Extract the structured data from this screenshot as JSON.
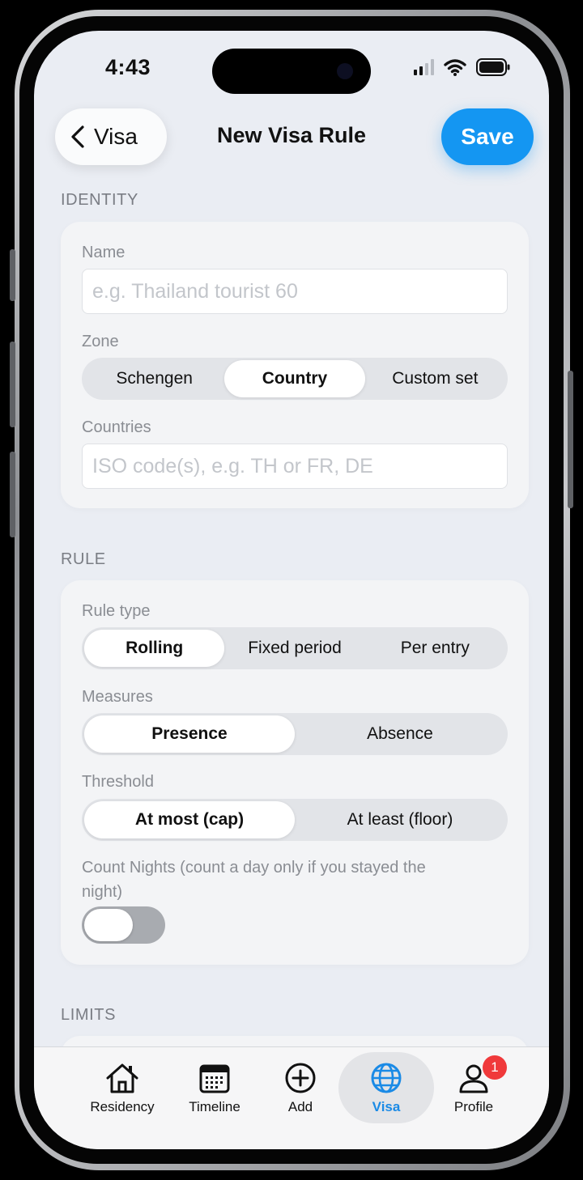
{
  "status_bar": {
    "time": "4:43"
  },
  "nav": {
    "back_label": "Visa",
    "title": "New Visa Rule",
    "save_label": "Save"
  },
  "identity": {
    "header": "IDENTITY",
    "name_label": "Name",
    "name_placeholder": "e.g. Thailand tourist 60",
    "zone_label": "Zone",
    "zone_options": [
      "Schengen",
      "Country",
      "Custom set"
    ],
    "zone_selected": "Country",
    "countries_label": "Countries",
    "countries_placeholder": "ISO code(s), e.g. TH or FR, DE"
  },
  "rule": {
    "header": "RULE",
    "rule_type_label": "Rule type",
    "rule_type_options": [
      "Rolling",
      "Fixed period",
      "Per entry"
    ],
    "rule_type_selected": "Rolling",
    "measures_label": "Measures",
    "measures_options": [
      "Presence",
      "Absence"
    ],
    "measures_selected": "Presence",
    "threshold_label": "Threshold",
    "threshold_options": [
      "At most (cap)",
      "At least (floor)"
    ],
    "threshold_selected": "At most (cap)",
    "count_nights_label": "Count Nights (count a day only if you stayed the night)",
    "count_nights_on": false
  },
  "limits": {
    "header": "LIMITS"
  },
  "tab_bar": {
    "tabs": [
      {
        "label": "Residency",
        "icon": "house-icon"
      },
      {
        "label": "Timeline",
        "icon": "calendar-icon"
      },
      {
        "label": "Add",
        "icon": "plus-circle-icon"
      },
      {
        "label": "Visa",
        "icon": "globe-icon"
      },
      {
        "label": "Profile",
        "icon": "person-icon"
      }
    ],
    "active": "Visa",
    "profile_badge": "1"
  },
  "colors": {
    "accent": "#1496f2",
    "badge": "#f0393b",
    "active_tab": "#1a8ae6"
  }
}
